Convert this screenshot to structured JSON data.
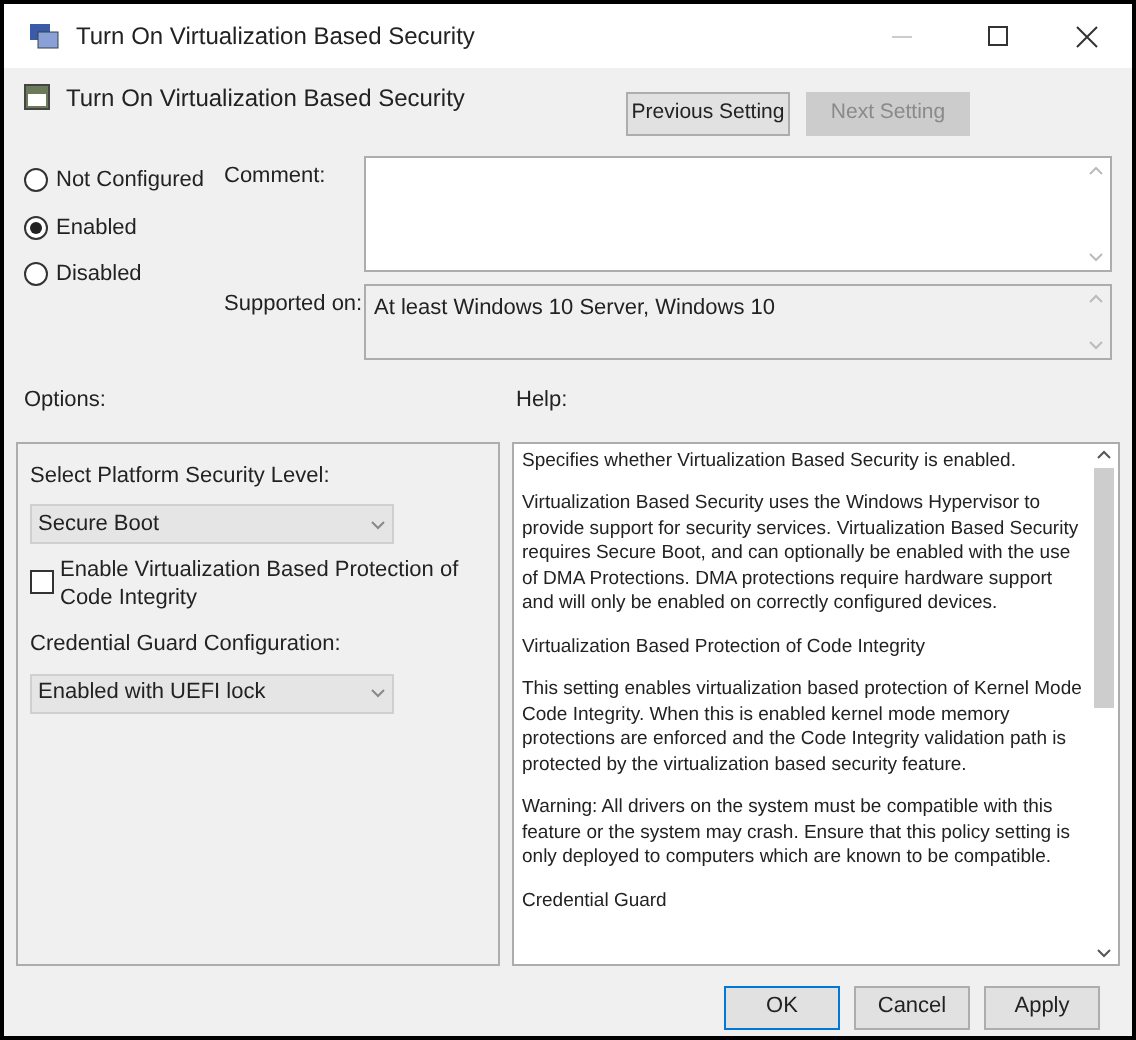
{
  "window": {
    "title": "Turn On Virtualization Based Security"
  },
  "header": {
    "policy_name": "Turn On Virtualization Based Security",
    "buttons": [
      {
        "label": "Previous Setting",
        "disabled": false
      },
      {
        "label": "Next Setting",
        "disabled": true
      }
    ]
  },
  "state_options": [
    {
      "label": "Not Configured",
      "selected": false
    },
    {
      "label": "Enabled",
      "selected": true
    },
    {
      "label": "Disabled",
      "selected": false
    }
  ],
  "comment": {
    "label": "Comment:"
  },
  "supported_on": {
    "label": "Supported on:",
    "value": "At least Windows 10 Server, Windows 10"
  },
  "options": {
    "label": "Options:",
    "items": [
      {
        "kind": "label",
        "text": "Select Platform Security Level:"
      },
      {
        "kind": "dropdown",
        "value": "Secure Boot"
      },
      {
        "kind": "checkbox",
        "text": "Enable Virtualization Based Protection of Code Integrity",
        "checked": false
      },
      {
        "kind": "label",
        "text": "Credential Guard Configuration:"
      },
      {
        "kind": "dropdown",
        "value": "Enabled with UEFI lock"
      }
    ]
  },
  "help": {
    "label": "Help:",
    "paragraphs": [
      "Specifies whether Virtualization Based Security is enabled.",
      "Virtualization Based Security uses the Windows Hypervisor to provide support for security services.  Virtualization Based Security requires Secure Boot, and can optionally be enabled with the use of DMA Protections.  DMA protections require hardware support and will only be enabled on correctly configured devices.",
      "Virtualization Based Protection of Code Integrity",
      "This setting enables virtualization based protection of Kernel Mode Code Integrity. When this is enabled kernel mode memory protections are enforced and the Code Integrity validation path is protected by the virtualization based security feature.",
      "Warning: All drivers on the system must be compatible with this feature or the system may crash. Ensure that this policy setting is only deployed to computers which are known to be compatible.",
      "Credential Guard"
    ]
  },
  "footer_buttons": [
    {
      "label": "OK",
      "default": true
    },
    {
      "label": "Cancel",
      "default": false
    },
    {
      "label": "Apply",
      "default": false
    }
  ]
}
